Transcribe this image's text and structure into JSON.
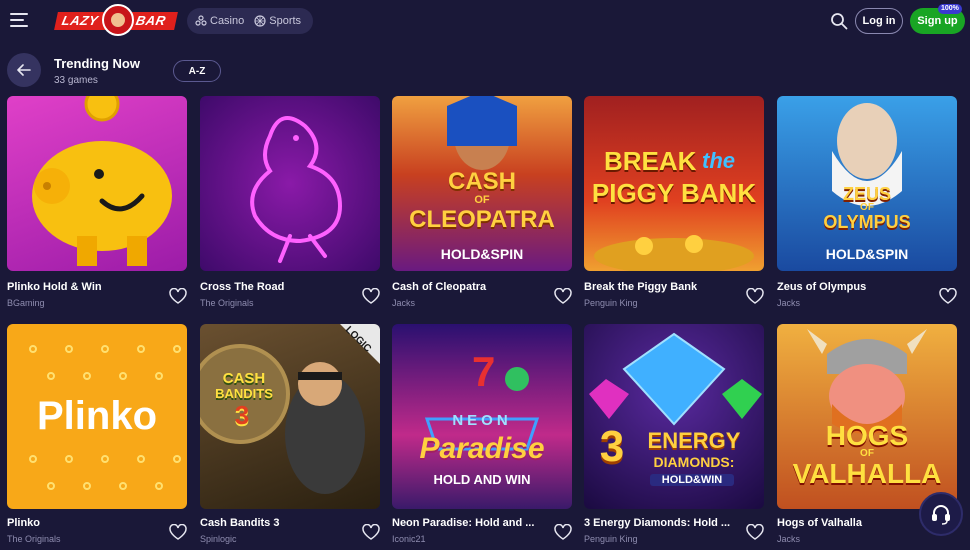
{
  "header": {
    "logo_left": "LAZY",
    "logo_right": "BAR",
    "nav": [
      {
        "label": "Casino",
        "icon": "casino-icon"
      },
      {
        "label": "Sports",
        "icon": "sports-ball-icon"
      }
    ],
    "login_label": "Log in",
    "signup_label": "Sign up",
    "signup_badge": "100%"
  },
  "page": {
    "title": "Trending Now",
    "subtitle": "33 games",
    "sort_label": "A-Z"
  },
  "games": [
    {
      "name": "Plinko Hold & Win",
      "provider": "BGaming"
    },
    {
      "name": "Cross The Road",
      "provider": "The Originals"
    },
    {
      "name": "Cash of Cleopatra",
      "provider": "Jacks",
      "art_line1": "CASH",
      "art_line2": "OF",
      "art_line3": "CLEOPATRA",
      "art_line4": "HOLD&SPIN"
    },
    {
      "name": "Break the Piggy Bank",
      "provider": "Penguin King",
      "art_line1": "BREAK",
      "art_line2": "the",
      "art_line3": "PIGGY BANK"
    },
    {
      "name": "Zeus of Olympus",
      "provider": "Jacks",
      "art_line1": "ZEUS",
      "art_line2": "OF",
      "art_line3": "OLYMPUS",
      "art_line4": "HOLD&SPIN"
    },
    {
      "name": "Plinko",
      "provider": "The Originals",
      "art_line1": "Plinko"
    },
    {
      "name": "Cash Bandits 3",
      "provider": "Spinlogic",
      "art_line1": "CASH",
      "art_line2": "BANDITS",
      "art_line3": "3",
      "art_line4": "LOGIC"
    },
    {
      "name": "Neon Paradise: Hold and ...",
      "provider": "Iconic21",
      "art_line1": "NEON",
      "art_line2": "Paradise",
      "art_line3": "HOLD AND WIN"
    },
    {
      "name": "3 Energy Diamonds: Hold ...",
      "provider": "Penguin King",
      "art_line1": "3",
      "art_line2": "ENERGY",
      "art_line3": "DIAMONDS:",
      "art_line4": "HOLD&WIN"
    },
    {
      "name": "Hogs of Valhalla",
      "provider": "Jacks",
      "art_line1": "HOGS",
      "art_line2": "OF",
      "art_line3": "VALHALLA"
    }
  ]
}
